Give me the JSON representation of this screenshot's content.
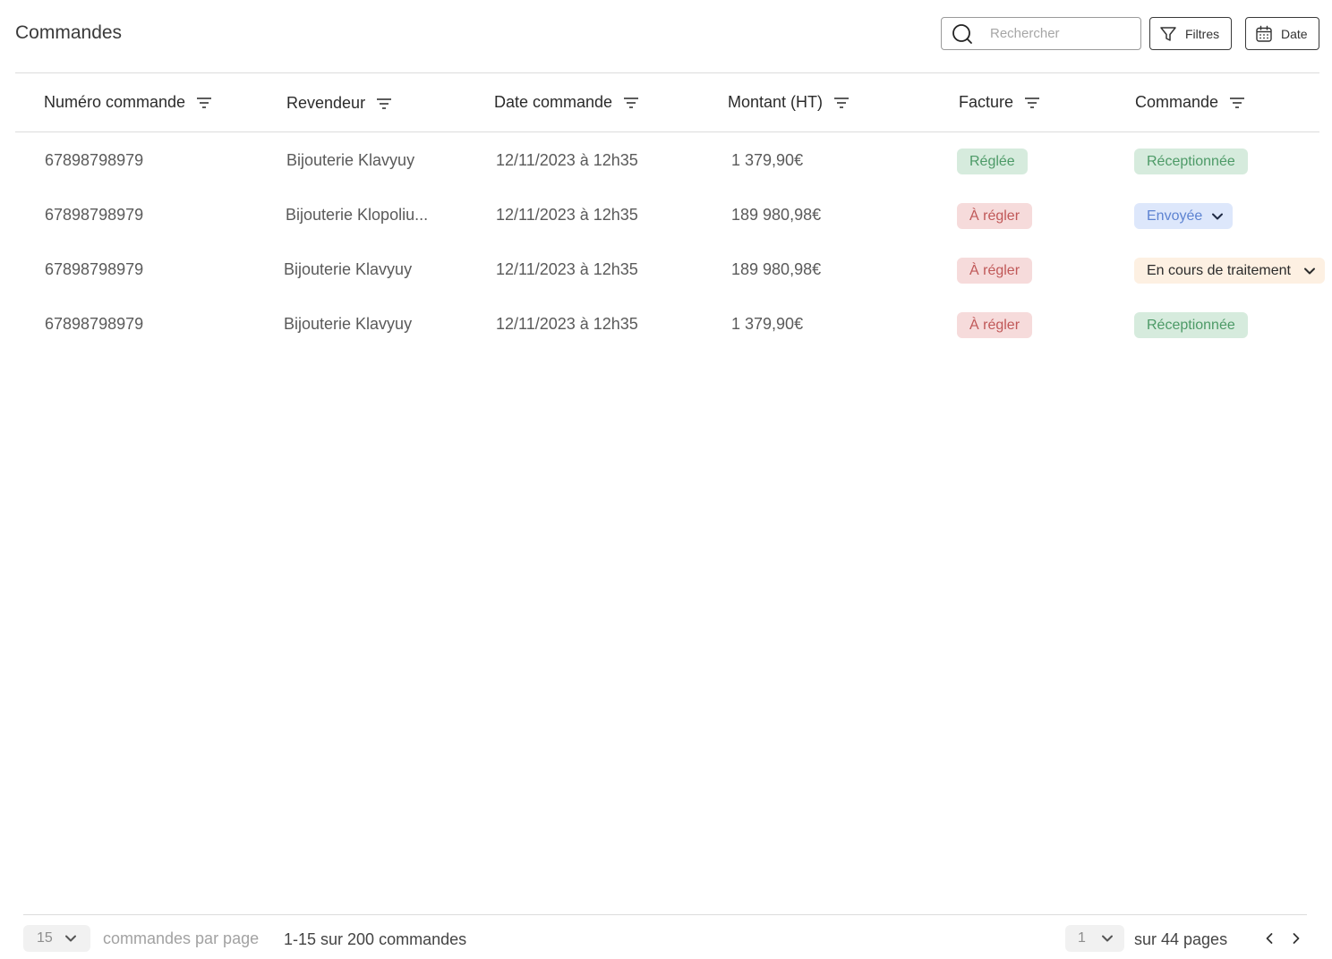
{
  "page": {
    "title": "Commandes"
  },
  "toolbar": {
    "search_placeholder": "Rechercher",
    "filters_label": "Filtres",
    "date_label": "Date"
  },
  "table": {
    "columns": [
      "Numéro commande",
      "Revendeur",
      "Date commande",
      "Montant (HT)",
      "Facture",
      "Commande"
    ],
    "rows": [
      {
        "order_number": "67898798979",
        "reseller": "Bijouterie Klavyuy",
        "date": "12/11/2023 à 12h35",
        "amount": "1 379,90€",
        "invoice_status": "Réglée",
        "invoice_color": "green",
        "order_status": "Réceptionnée",
        "order_color": "green",
        "order_dropdown": false
      },
      {
        "order_number": "67898798979",
        "reseller": "Bijouterie Klopoliu...",
        "date": "12/11/2023 à 12h35",
        "amount": "189 980,98€",
        "invoice_status": "À régler",
        "invoice_color": "red",
        "order_status": "Envoyée",
        "order_color": "blue",
        "order_dropdown": true
      },
      {
        "order_number": "67898798979",
        "reseller": "Bijouterie Klavyuy",
        "date": "12/11/2023 à 12h35",
        "amount": "189 980,98€",
        "invoice_status": "À régler",
        "invoice_color": "red",
        "order_status": "En cours de traitement",
        "order_color": "orange",
        "order_dropdown": true
      },
      {
        "order_number": "67898798979",
        "reseller": "Bijouterie Klavyuy",
        "date": "12/11/2023 à 12h35",
        "amount": "1 379,90€",
        "invoice_status": "À régler",
        "invoice_color": "red",
        "order_status": "Réceptionnée",
        "order_color": "green",
        "order_dropdown": false
      }
    ]
  },
  "pagination": {
    "per_page_value": "15",
    "per_page_label": "commandes par page",
    "range_text": "1-15 sur 200 commandes",
    "current_page": "1",
    "pages_total_text": "sur 44 pages"
  },
  "colors": {
    "green_bg": "#d6ebdd",
    "green_text": "#4d9a67",
    "red_bg": "#f6dbdb",
    "red_text": "#c05858",
    "blue_bg": "#dde7fb",
    "blue_text": "#5d83d1",
    "orange_bg": "#fdf0e2"
  },
  "icons": [
    "search-icon",
    "filter-funnel-icon",
    "calendar-icon",
    "column-filter-icon",
    "chevron-down-icon",
    "chevron-left-icon",
    "chevron-right-icon"
  ]
}
